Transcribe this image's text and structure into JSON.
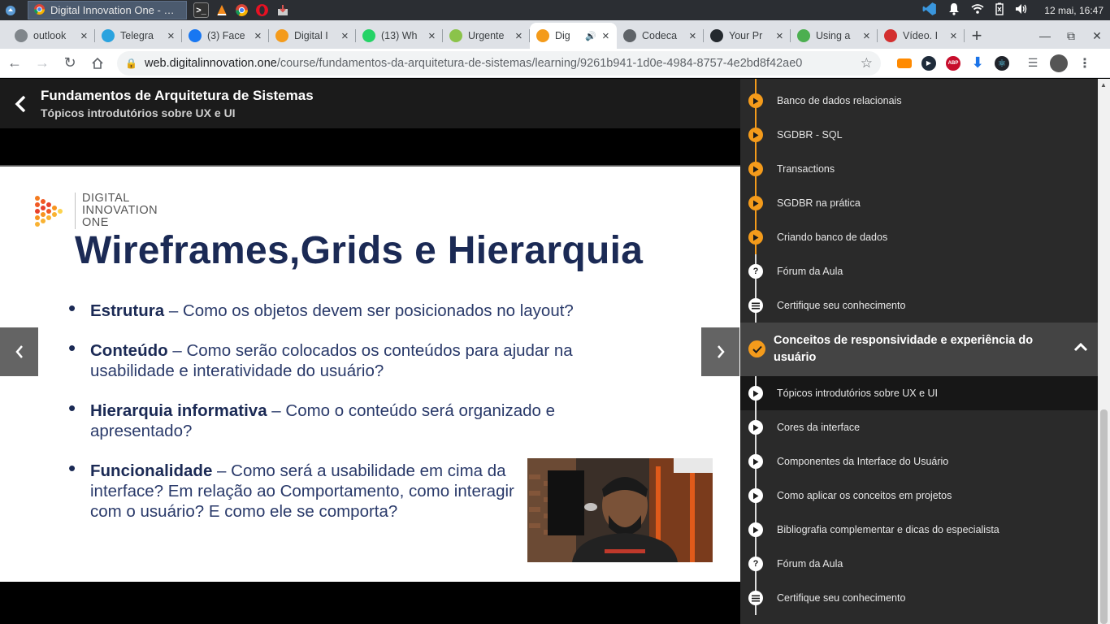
{
  "taskbar": {
    "active_task": "Digital Innovation One - Goo...",
    "clock": "12 mai, 16:47"
  },
  "tabs": [
    {
      "title": "outlook",
      "fav_color": "#80868b"
    },
    {
      "title": "Telegra",
      "fav_color": "#2aa3df"
    },
    {
      "title": "(3) Face",
      "fav_color": "#1877f2"
    },
    {
      "title": "Digital I",
      "fav_color": "#f49b1b"
    },
    {
      "title": "(13) Wh",
      "fav_color": "#25d366"
    },
    {
      "title": "Urgente",
      "fav_color": "#8bc34a"
    },
    {
      "title": "Dig",
      "fav_color": "#f49b1b",
      "active": true
    },
    {
      "title": "Codeca",
      "fav_color": "#5f6368"
    },
    {
      "title": "Your Pr",
      "fav_color": "#24292e"
    },
    {
      "title": "Using a",
      "fav_color": "#4caf50"
    },
    {
      "title": "Vídeo. I",
      "fav_color": "#d32f2f"
    }
  ],
  "address": {
    "host": "web.digitalinnovation.one",
    "path": "/course/fundamentos-da-arquitetura-de-sistemas/learning/9261b941-1d0e-4984-8757-4e2bd8f42ae0"
  },
  "course": {
    "title": "Fundamentos de Arquitetura de Sistemas",
    "subtitle": "Tópicos introdutórios sobre UX e UI"
  },
  "slide": {
    "logo_line1": "DIGITAL",
    "logo_line2": "INNOVATION",
    "logo_line3": "ONE",
    "title": "Wireframes,Grids e Hierarquia",
    "bullets": [
      {
        "term": "Estrutura",
        "text": " – Como os objetos devem ser posicionados no layout?"
      },
      {
        "term": "Conteúdo",
        "text": " – Como serão colocados os conteúdos para ajudar na usabilidade e interatividade do usuário?"
      },
      {
        "term": "Hierarquia informativa",
        "text": " – Como o conteúdo será organizado e apresentado?"
      },
      {
        "term": "Funcionalidade",
        "text": " – Como será a usabilidade em cima da interface? Em relação ao Comportamento, como interagir com o usuário? E como ele se comporta?"
      }
    ]
  },
  "sidebar": {
    "prev_lessons": [
      {
        "label": "Banco de dados relacionais",
        "icon": "play-icon"
      },
      {
        "label": "SGDBR - SQL",
        "icon": "play-icon"
      },
      {
        "label": "Transactions",
        "icon": "play-icon"
      },
      {
        "label": "SGDBR na prática",
        "icon": "play-icon"
      },
      {
        "label": "Criando banco de dados",
        "icon": "play-icon"
      },
      {
        "label": "Fórum da Aula",
        "icon": "question-icon"
      },
      {
        "label": "Certifique seu conhecimento",
        "icon": "list-icon"
      }
    ],
    "section_title": "Conceitos de responsividade e experiência do usuário",
    "section_lessons": [
      {
        "label": "Tópicos introdutórios sobre UX e UI",
        "icon": "play-icon",
        "current": true
      },
      {
        "label": "Cores da interface",
        "icon": "play-icon"
      },
      {
        "label": "Componentes da Interface do Usuário",
        "icon": "play-icon"
      },
      {
        "label": "Como aplicar os conceitos em projetos",
        "icon": "play-icon"
      },
      {
        "label": "Bibliografia complementar e dicas do especialista",
        "icon": "play-icon"
      },
      {
        "label": "Fórum da Aula",
        "icon": "question-icon"
      },
      {
        "label": "Certifique seu conhecimento",
        "icon": "list-icon"
      }
    ]
  },
  "colors": {
    "accent": "#f49b1b",
    "slide_text": "#1b2a55"
  }
}
